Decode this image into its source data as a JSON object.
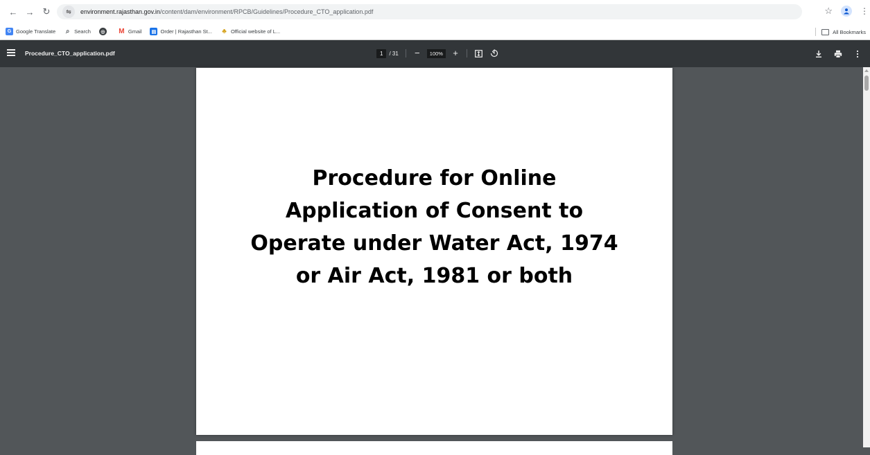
{
  "browser": {
    "url_host": "environment.rajasthan.gov.in",
    "url_path": "/content/dam/environment/RPCB/Guidelines/Procedure_CTO_application.pdf",
    "nav_icons": [
      "back-icon",
      "forward-icon",
      "reload-icon"
    ]
  },
  "bookmarks": {
    "items": [
      {
        "label": "Google Translate",
        "icon": "google-translate-icon",
        "color": "#4285f4"
      },
      {
        "label": "Search",
        "icon": "search-icon",
        "color": "#5f6368"
      },
      {
        "label": "",
        "icon": "chrome-icon",
        "color": "#3c4043"
      },
      {
        "label": "Gmail",
        "icon": "gmail-icon",
        "color": "#ea4335"
      },
      {
        "label": "Order | Rajasthan St...",
        "icon": "order-icon",
        "color": "#1a73e8"
      },
      {
        "label": "Official website of L...",
        "icon": "emblem-icon",
        "color": "#d4a017"
      }
    ],
    "all_bookmarks": "All Bookmarks"
  },
  "pdf_toolbar": {
    "title": "Procedure_CTO_application.pdf",
    "current_page": "1",
    "total_pages": "/ 31",
    "zoom": "100%",
    "zoom_out": "−",
    "zoom_in": "+"
  },
  "document": {
    "title_lines": [
      "Procedure for Online",
      "Application of Consent to",
      "Operate under Water Act, 1974",
      "or Air Act, 1981 or both"
    ]
  }
}
